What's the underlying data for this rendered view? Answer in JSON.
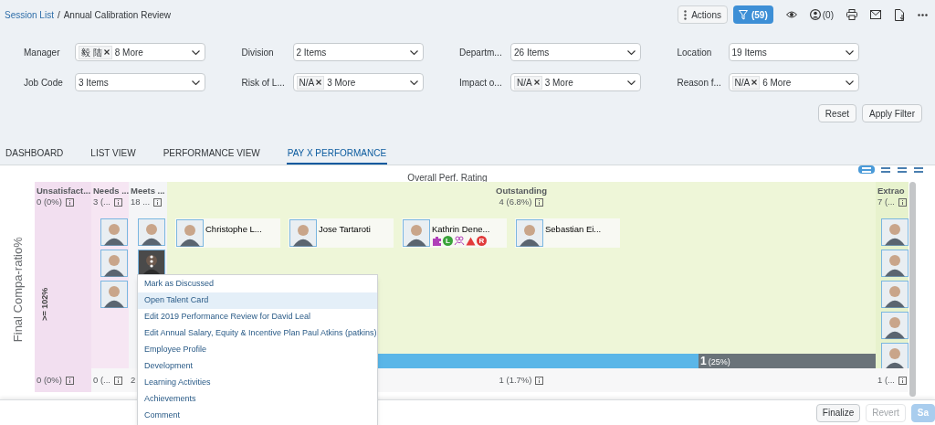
{
  "breadcrumb": {
    "link": "Session List",
    "separator": "/",
    "current": "Annual Calibration Review"
  },
  "toolbar": {
    "actions": "Actions",
    "filter_count": "(59)",
    "hidden_count": "(0)"
  },
  "filters": [
    {
      "label": "Manager",
      "tokens": [
        "毅 陆"
      ],
      "value": "8 More"
    },
    {
      "label": "Division",
      "value": "2 Items"
    },
    {
      "label": "Departm...",
      "value": "26 Items"
    },
    {
      "label": "Location",
      "value": "19 Items"
    },
    {
      "label": "Job Code",
      "value": "3 Items"
    },
    {
      "label": "Risk of L...",
      "tokens": [
        "N/A"
      ],
      "value": "3 More"
    },
    {
      "label": "Impact o...",
      "tokens": [
        "N/A"
      ],
      "value": "3 More"
    },
    {
      "label": "Reason f...",
      "tokens": [
        "N/A"
      ],
      "value": "6 More"
    }
  ],
  "filter_buttons": [
    "Reset",
    "Apply Filter"
  ],
  "tabs": [
    {
      "label": "DASHBOARD",
      "selected": false
    },
    {
      "label": "LIST VIEW",
      "selected": false
    },
    {
      "label": "PERFORMANCE VIEW",
      "selected": false
    },
    {
      "label": "PAY X PERFORMANCE",
      "selected": true
    }
  ],
  "grid": {
    "title": "Overall Perf. Rating",
    "view_modes": [
      {
        "selected": true
      },
      {
        "selected": false
      },
      {
        "selected": false
      },
      {
        "selected": false
      }
    ],
    "y_axis_label": "Final Compa-ratio%",
    "row_label": ">= 102%",
    "columns": [
      {
        "name": "Unsatisfact...",
        "count": "0 (0%)",
        "bottom_count": "0 (0%)",
        "color": "#f2dff0"
      },
      {
        "name": "Needs ...",
        "count": "3 (...",
        "bottom_count": "0 (...",
        "color": "#f6e6f3",
        "people": [
          {
            "kind": "avatar",
            "active": false
          },
          {
            "kind": "avatar",
            "active": false
          },
          {
            "kind": "avatar",
            "active": false
          }
        ]
      },
      {
        "name": "Meets ...",
        "count": "18 ...",
        "bottom_count": "2",
        "color": "#f4f5f7",
        "people": [
          {
            "kind": "avatar",
            "active": false
          },
          {
            "kind": "avatar",
            "active": true
          }
        ]
      },
      {
        "name": "Outstanding",
        "count": "4 (6.8%)",
        "bottom_count": "1 (1.7%)",
        "color": "#eef6d8",
        "people": [
          {
            "kind": "card",
            "name": "Christophe L..."
          },
          {
            "kind": "card",
            "name": "Jose Tartaroti"
          },
          {
            "kind": "card",
            "name": "Kathrin Dene...",
            "badges": [
              {
                "kind": "puzzle"
              },
              {
                "kind": "letter",
                "text": "L",
                "color": "#3aa23a"
              },
              {
                "kind": "people"
              },
              {
                "kind": "warning"
              },
              {
                "kind": "letter",
                "text": "R",
                "color": "#e03b3b"
              }
            ]
          },
          {
            "kind": "card",
            "name": "Sebastian Ei..."
          }
        ],
        "bar": {
          "level": 0.75,
          "count": "1",
          "share": "(25%)"
        }
      },
      {
        "name": "Extrao",
        "count": "7 (...",
        "bottom_count": "1 (...",
        "color": "#e7f2cd",
        "people": [
          {
            "kind": "avatar",
            "active": false
          },
          {
            "kind": "avatar",
            "active": false
          },
          {
            "kind": "avatar",
            "active": false
          },
          {
            "kind": "avatar",
            "active": false
          },
          {
            "kind": "avatar",
            "active": false
          }
        ]
      }
    ]
  },
  "context_menu": [
    {
      "label": "Mark as Discussed",
      "selected": false
    },
    {
      "label": "Open Talent Card",
      "selected": true
    },
    {
      "label": "Edit 2019 Performance Review for David Leal",
      "selected": false
    },
    {
      "label": "Edit Annual Salary, Equity & Incentive Plan Paul Atkins (patkins)",
      "selected": false
    },
    {
      "label": "Employee Profile",
      "selected": false
    },
    {
      "label": "Development",
      "selected": false
    },
    {
      "label": "Learning Activities",
      "selected": false
    },
    {
      "label": "Achievements",
      "selected": false
    },
    {
      "label": "Comment",
      "selected": false
    }
  ],
  "footer_buttons": [
    {
      "label": "Finalize",
      "kind": "default",
      "disabled": false
    },
    {
      "label": "Revert",
      "kind": "default",
      "disabled": true
    },
    {
      "label": "Sa",
      "kind": "primary",
      "disabled": true
    }
  ]
}
